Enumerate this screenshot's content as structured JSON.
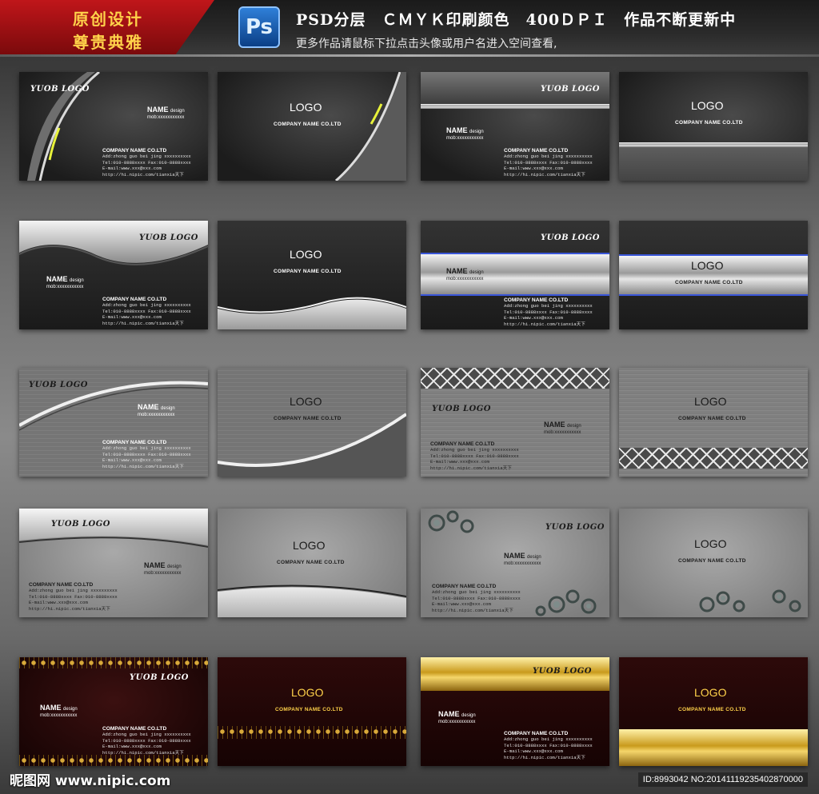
{
  "header": {
    "badge_line1": "原创设计",
    "badge_line2": "尊贵典雅",
    "ps_icon": "Ps",
    "title": "PSD分层　ＣＭＹＫ印刷颜色　400ＤＰＩ　作品不断更新中",
    "subtitle": "更多作品请鼠标下拉点击头像或用户名进入空间查看,"
  },
  "card_text": {
    "logo": "LOGO",
    "yuob_logo": "YUOB LOGO",
    "company_name_front": "COMPANY NAME CO.LTD",
    "name": "NAME",
    "design": "design",
    "mob": "mob:xxxxxxxxxxx",
    "company": "COMPANY NAME CO.LTD",
    "addr": "Add:zhong guo bei jing xxxxxxxxxx",
    "tel": "Tel:010-8888xxxx Fax:010-8888xxxx",
    "email": "E-mail:www.xxx@xxx.com",
    "url": "http://hi.nipic.com/tianxia天下"
  },
  "colors": {
    "header_red": "#c0161a",
    "badge_text": "#ffd24a",
    "ps_blue": "#2f7fd8",
    "gold": "#c99a1c",
    "maroon": "#2d0a0a"
  },
  "footer": {
    "watermark": "昵图网 www.nipic.com",
    "id": "ID:8993042 NO:20141119235402870000"
  }
}
